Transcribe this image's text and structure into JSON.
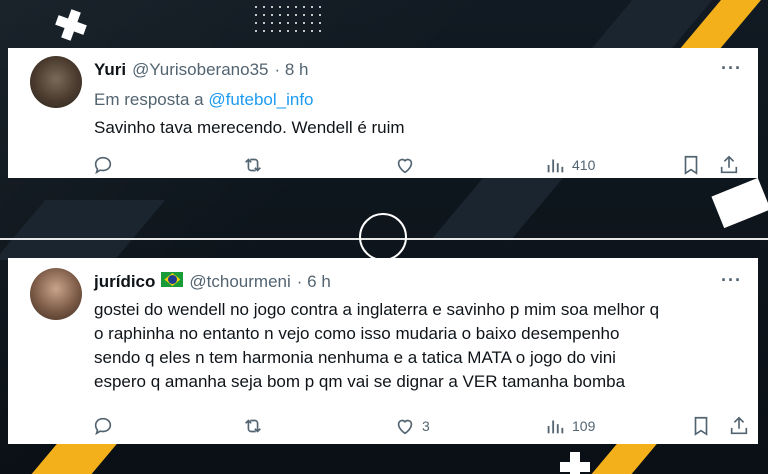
{
  "tweets": [
    {
      "name": "Yuri",
      "handle": "@Yurisoberano35",
      "time": "· 8 h",
      "reply_prefix": "Em resposta a",
      "reply_handle": "@futebol_info",
      "lines": [
        "Savinho tava merecendo. Wendell é ruim"
      ],
      "likes": "",
      "views": "410",
      "more": "···"
    },
    {
      "name": "jurídico",
      "has_flag": true,
      "handle": "@tchourmeni",
      "time": "· 6 h",
      "lines": [
        "gostei do wendell no jogo contra a inglaterra e savinho p mim soa melhor q",
        "o raphinha no entanto n vejo como isso mudaria o baixo desempenho",
        "sendo q eles n tem harmonia nenhuma e a tatica MATA o jogo do vini",
        "espero q amanha seja bom p qm vai se dignar a VER tamanha bomba"
      ],
      "likes": "3",
      "views": "109",
      "more": "···"
    }
  ],
  "icons": {
    "reply": "reply-icon",
    "retweet": "retweet-icon",
    "like": "heart-icon",
    "views": "views-icon",
    "bookmark": "bookmark-icon",
    "share": "share-icon",
    "more": "more-icon",
    "flag": "brazil-flag-icon"
  },
  "colors": {
    "accent_link": "#1d9bf0",
    "text_primary": "#0f1419",
    "text_secondary": "#536471",
    "background": "#0b1219",
    "stripe_gold": "#f3b01a"
  }
}
